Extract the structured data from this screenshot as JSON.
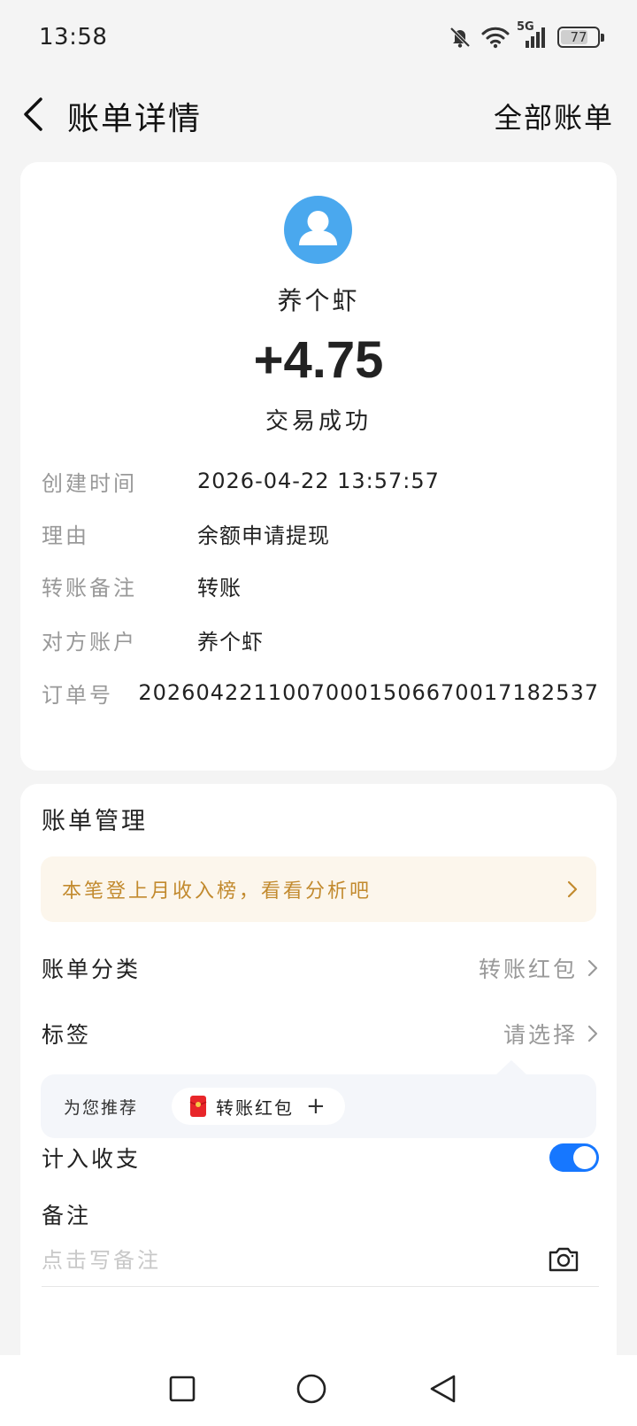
{
  "status_bar": {
    "time": "13:58",
    "battery": "77",
    "battery_level": 0.77,
    "network": "5G",
    "icons": [
      "mute-bell-icon",
      "wifi-icon",
      "signal-icon",
      "battery-icon"
    ]
  },
  "nav": {
    "title": "账单详情",
    "all_bills": "全部账单",
    "back_icon": "chevron-left-icon"
  },
  "transaction": {
    "payee": "养个虾",
    "amount": "+4.75",
    "status": "交易成功",
    "avatar_color": "#4aa8ee"
  },
  "details": [
    {
      "label": "创建时间",
      "value": "2026-04-22 13:57:57"
    },
    {
      "label": "理由",
      "value": "余额申请提现"
    },
    {
      "label": "转账备注",
      "value": "转账"
    },
    {
      "label": "对方账户",
      "value": "养个虾"
    },
    {
      "label": "订单号",
      "value": "20260422110070001506670017182537"
    }
  ],
  "management": {
    "title": "账单管理",
    "banner": "本笔登上月收入榜，看看分析吧",
    "category_label": "账单分类",
    "category_value": "转账红包",
    "tags_label": "标签",
    "tags_value": "请选择",
    "recommend_label": "为您推荐",
    "recommend_chip": "转账红包",
    "recommend_plus": "+",
    "count_label": "计入收支",
    "count_enabled": true,
    "note_label": "备注",
    "note_placeholder": "点击写备注",
    "note_value": ""
  },
  "colors": {
    "accent": "#1677ff",
    "banner_text": "#c28a2e",
    "banner_bg": "#fcf6ec",
    "red_packet": "#e8262a"
  }
}
